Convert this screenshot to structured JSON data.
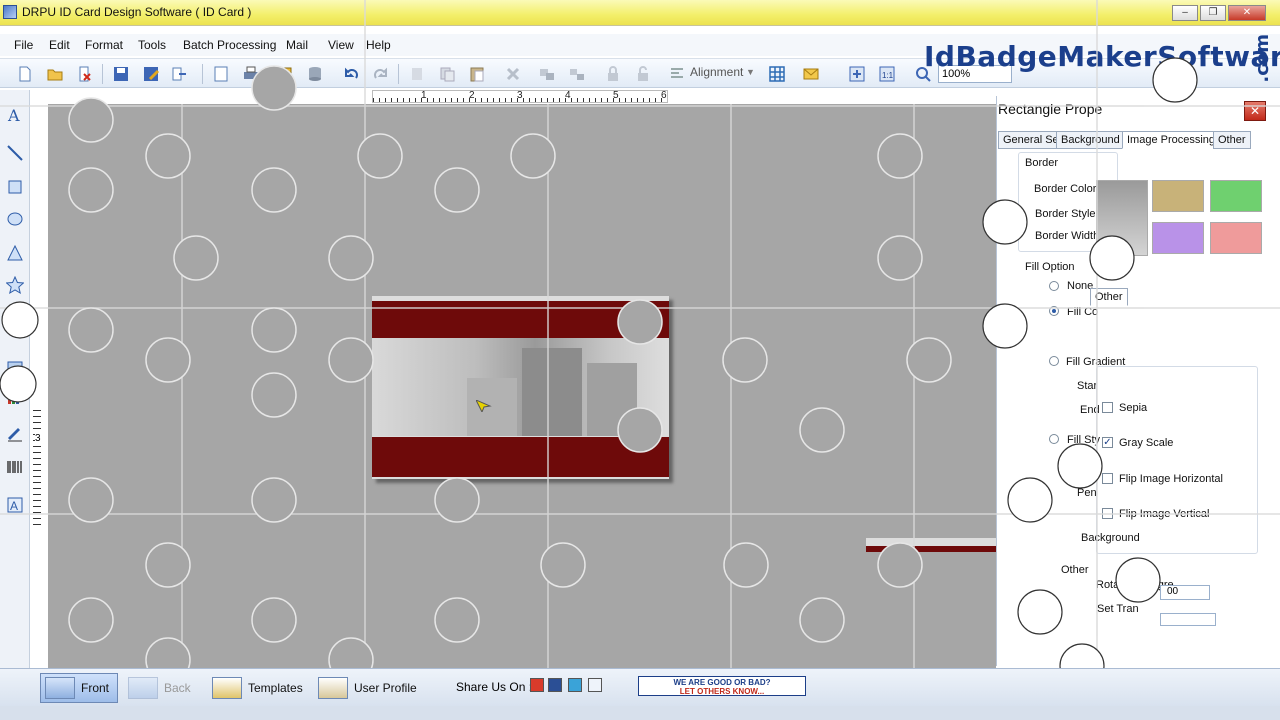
{
  "window": {
    "title": "DRPU ID Card Design Software ( ID Card )",
    "controls": [
      "–",
      "❐",
      "✕"
    ]
  },
  "menu": [
    "File",
    "Edit",
    "Format",
    "Tools",
    "Batch Processing",
    "Mail",
    "View",
    "Help"
  ],
  "toolbar": {
    "alignment_label": "Alignment",
    "zoom_value": "100%"
  },
  "brand": {
    "name": "IdBadgeMakerSoftware",
    "tld": ".com"
  },
  "ruler": {
    "h_labels": [
      "1",
      "2",
      "3",
      "4",
      "5",
      "6"
    ],
    "v_label": "3"
  },
  "panel": {
    "title": "Rectangle Prope",
    "close": "✕",
    "tabs": [
      "General Settin",
      "Background",
      "Image Processing",
      "Other"
    ],
    "border_section": "Border",
    "border_color": "Border Color",
    "border_style": "Border Style",
    "border_width": "Border Width",
    "fill_option": "Fill Option",
    "fill_none": "None",
    "fill_color": "Fill Co",
    "fill_gradient": "Fill Gradient",
    "start": "Star",
    "end": "End",
    "fill_style": "Fill Sty",
    "pen": "Pen",
    "other_tab": "Other",
    "sepia": "Sepia",
    "gray_scale": "Gray Scale",
    "flip_h": "Flip Image Horizontal",
    "flip_v": "Flip Image Vertical",
    "background": "Background",
    "other_section": "Other",
    "rotation": "Rotation (Degre",
    "rotation_value": "00",
    "set_trans": "Set Tran",
    "gray_scale_checked": true
  },
  "swatches": [
    "#b9b9b9",
    "#c8b279",
    "#6fd06f",
    "#b992e8",
    "#ef9b9b"
  ],
  "bottom": {
    "front": "Front",
    "back": "Back",
    "templates": "Templates",
    "user_profile": "User Profile",
    "share_label": "Share Us On :",
    "feedback_line1": "WE ARE GOOD OR BAD?",
    "feedback_line2": "LET OTHERS KNOW..."
  },
  "card": {
    "band_color": "#6e0a0a"
  }
}
